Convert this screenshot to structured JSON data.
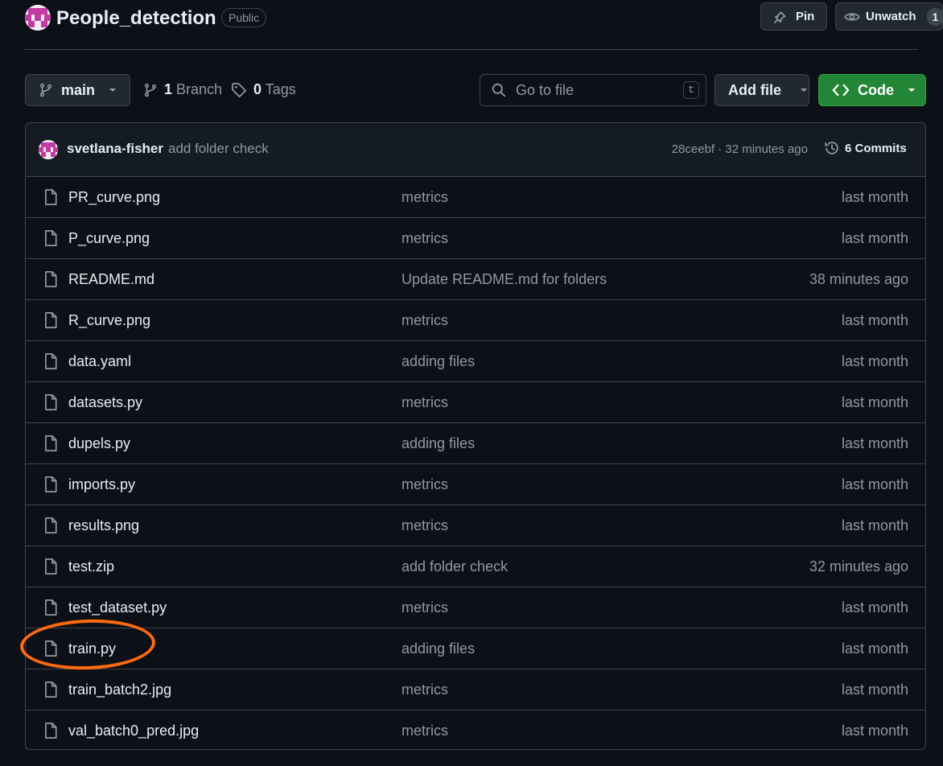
{
  "repo": {
    "name": "People_detection",
    "visibility": "Public",
    "pin_label": "Pin",
    "watch_label": "Unwatch",
    "watch_count": "1",
    "avatar_colors": {
      "bg": "#f3eaf3",
      "fg": "#c23ba3"
    }
  },
  "toolbar": {
    "branch": "main",
    "branches_count": "1",
    "branches_label": "Branch",
    "tags_count": "0",
    "tags_label": "Tags",
    "search_placeholder": "Go to file",
    "search_shortcut": "t",
    "add_file_label": "Add file",
    "code_label": "Code"
  },
  "latest_commit": {
    "author": "svetlana-fisher",
    "message": "add folder check",
    "hash_time": "28ceebf · 32 minutes ago",
    "commits_label": "6 Commits"
  },
  "files": [
    {
      "name": "PR_curve.png",
      "message": "metrics",
      "date": "last month"
    },
    {
      "name": "P_curve.png",
      "message": "metrics",
      "date": "last month"
    },
    {
      "name": "README.md",
      "message": "Update README.md for folders",
      "date": "38 minutes ago"
    },
    {
      "name": "R_curve.png",
      "message": "metrics",
      "date": "last month"
    },
    {
      "name": "data.yaml",
      "message": "adding files",
      "date": "last month"
    },
    {
      "name": "datasets.py",
      "message": "metrics",
      "date": "last month"
    },
    {
      "name": "dupels.py",
      "message": "adding files",
      "date": "last month"
    },
    {
      "name": "imports.py",
      "message": "metrics",
      "date": "last month"
    },
    {
      "name": "results.png",
      "message": "metrics",
      "date": "last month"
    },
    {
      "name": "test.zip",
      "message": "add folder check",
      "date": "32 minutes ago"
    },
    {
      "name": "test_dataset.py",
      "message": "metrics",
      "date": "last month"
    },
    {
      "name": "train.py",
      "message": "adding files",
      "date": "last month"
    },
    {
      "name": "train_batch2.jpg",
      "message": "metrics",
      "date": "last month"
    },
    {
      "name": "val_batch0_pred.jpg",
      "message": "metrics",
      "date": "last month"
    }
  ],
  "colors": {
    "background": "#0d1117",
    "code_button": "#238636",
    "highlight_circle": "#ff6a10"
  }
}
